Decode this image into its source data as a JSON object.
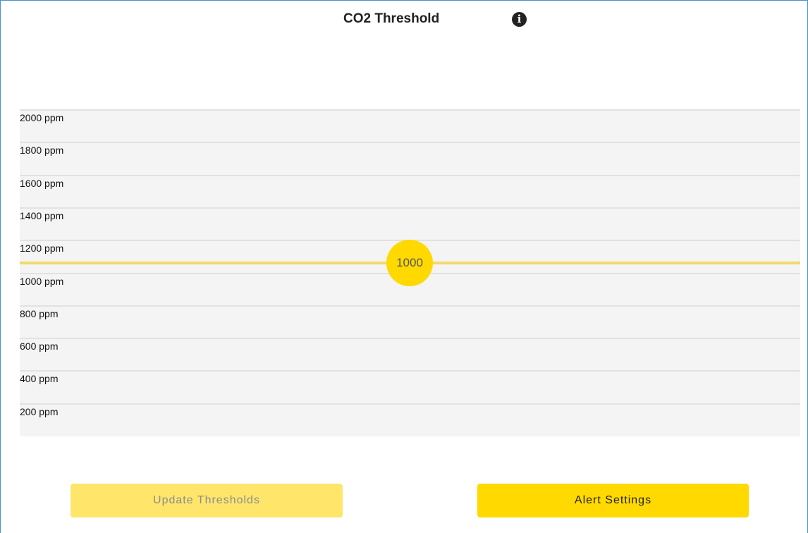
{
  "header": {
    "title": "CO2 Threshold",
    "info_icon": "info-icon"
  },
  "chart_data": {
    "type": "threshold-slider",
    "y_ticks": [
      "2000 ppm",
      "1800 ppm",
      "1600 ppm",
      "1400 ppm",
      "1200 ppm",
      "1000 ppm",
      "800 ppm",
      "600 ppm",
      "400 ppm",
      "200 ppm"
    ],
    "y_values": [
      2000,
      1800,
      1600,
      1400,
      1200,
      1000,
      800,
      600,
      400,
      200
    ],
    "ylim": [
      100,
      2000
    ],
    "threshold": 1000,
    "threshold_label": "1000",
    "threshold_color": "#ffd900",
    "threshold_line_color": "#f2d96a"
  },
  "buttons": {
    "update_label": "Update Thresholds",
    "update_disabled": true,
    "alert_label": "Alert Settings"
  },
  "colors": {
    "accent": "#ffd900",
    "accent_disabled": "#ffe66b",
    "border": "#4a90c8"
  }
}
